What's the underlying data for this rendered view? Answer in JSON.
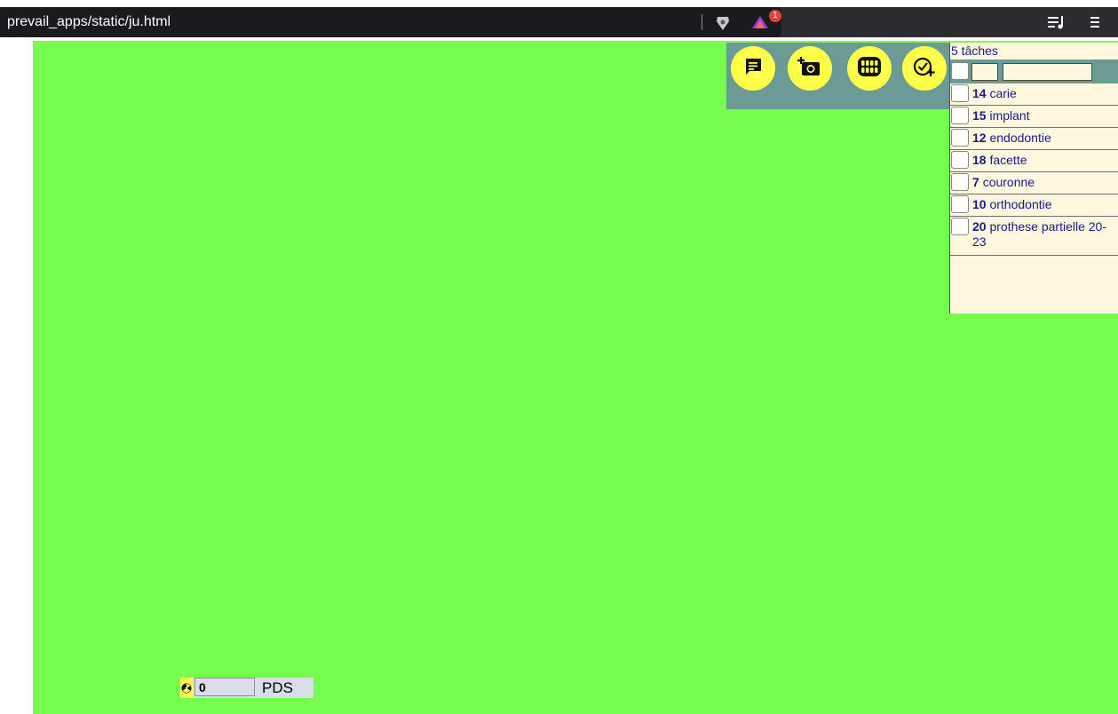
{
  "browser": {
    "url": "prevail_apps/static/ju.html",
    "notification_count": "1"
  },
  "toolbar": {
    "buttons": [
      {
        "icon": "message-icon"
      },
      {
        "icon": "add-photo-icon"
      },
      {
        "icon": "teeth-icon"
      },
      {
        "icon": "add-task-icon"
      }
    ]
  },
  "tasks_panel": {
    "count_label": "5 tâches",
    "items": [
      {
        "number": "14",
        "label": "carie"
      },
      {
        "number": "15",
        "label": "implant"
      },
      {
        "number": "12",
        "label": "endodontie"
      },
      {
        "number": "18",
        "label": "facette"
      },
      {
        "number": "7",
        "label": "couronne"
      },
      {
        "number": "10",
        "label": "orthodontie"
      },
      {
        "number": "20",
        "label": "prothese partielle 20-23"
      }
    ]
  },
  "footer": {
    "value": "0",
    "label": "PDS"
  },
  "colors": {
    "background": "#77fd4e",
    "toolbar": "#6b9b94",
    "button": "#ffff4a",
    "panel": "#fff7de"
  }
}
